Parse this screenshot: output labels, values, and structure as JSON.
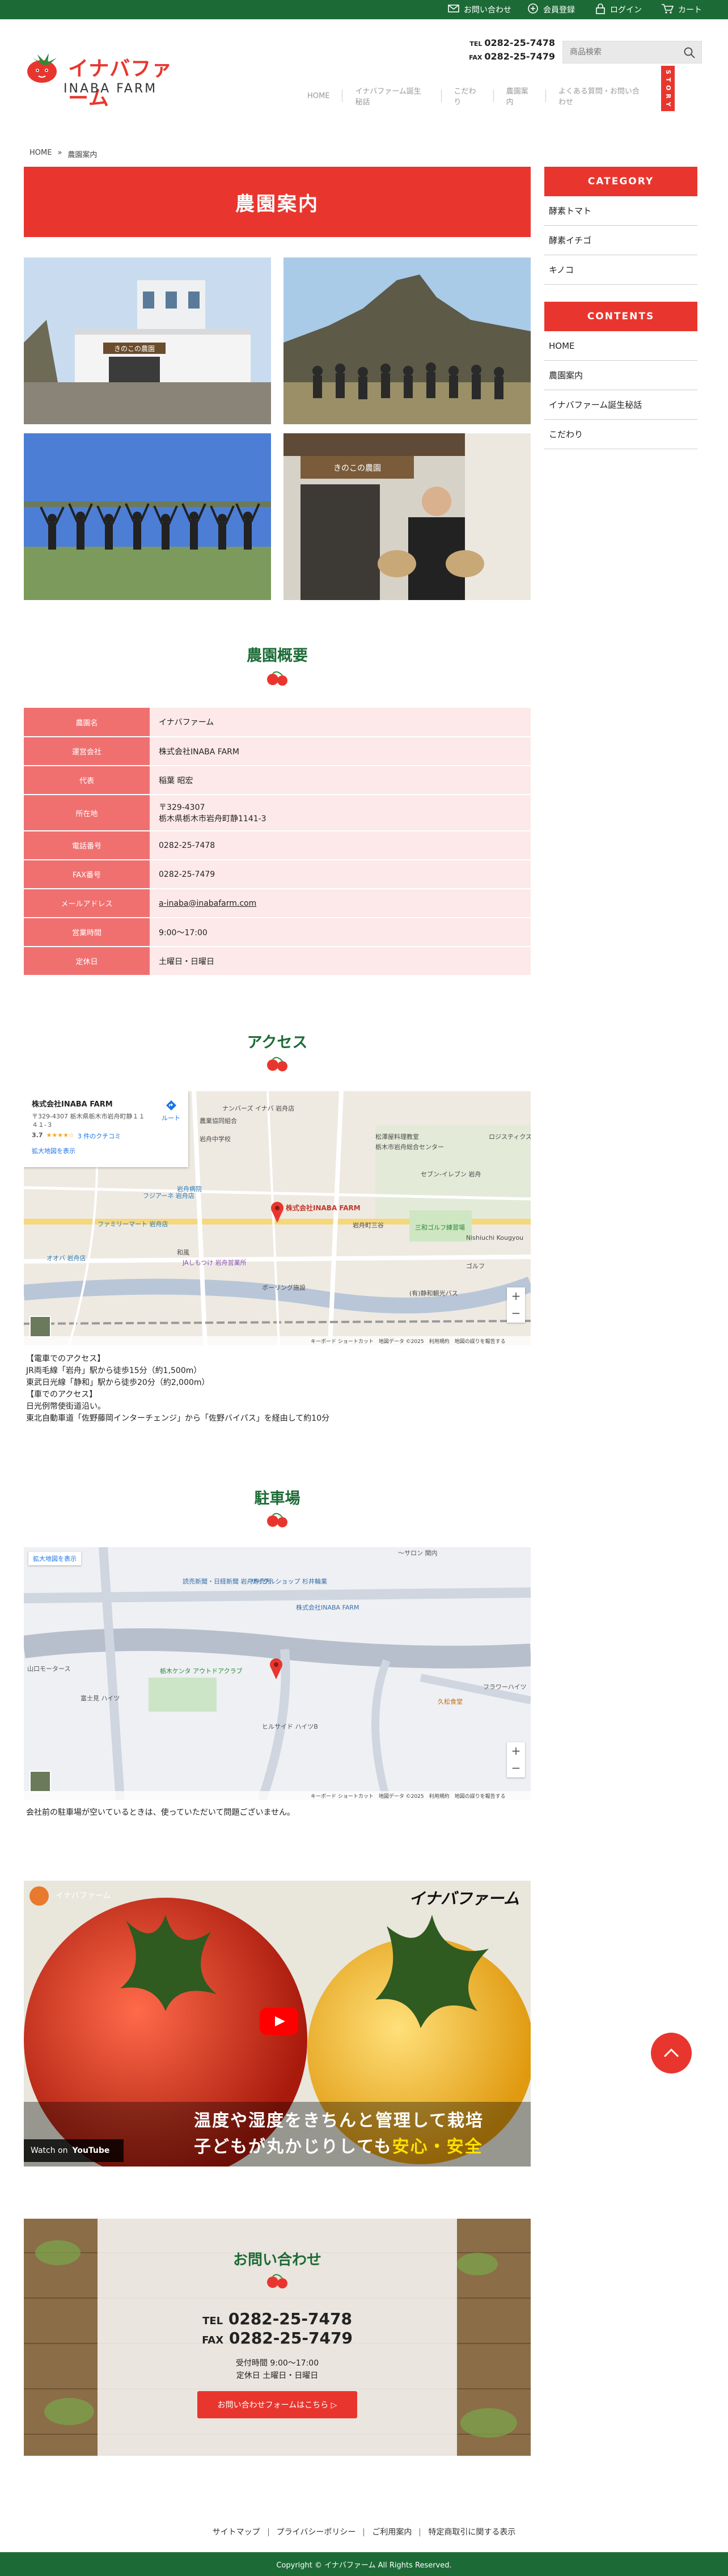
{
  "topbar": {
    "contact": "お問い合わせ",
    "register": "会員登録",
    "login": "ログイン",
    "cart": "カート"
  },
  "header": {
    "logo_jp": "イナバファーム",
    "logo_en": "INABA FARM",
    "tel_label": "TEL",
    "tel": "0282-25-7478",
    "fax_label": "FAX",
    "fax": "0282-25-7479",
    "search_placeholder": "商品検索",
    "story": "S T O R Y",
    "nav": [
      "HOME",
      "イナバファーム誕生秘話",
      "こだわり",
      "農園案内",
      "よくある質問・お問い合わせ"
    ]
  },
  "breadcrumb": {
    "home": "HOME",
    "sep": "»",
    "current": "農園案内"
  },
  "page_title": "農園案内",
  "photos": {
    "p1_sign": "きのこの農園",
    "p4_sign": "きのこの農園"
  },
  "overview": {
    "title": "農園概要",
    "rows": [
      {
        "label": "農園名",
        "value": "イナバファーム"
      },
      {
        "label": "運営会社",
        "value": "株式会社INABA FARM"
      },
      {
        "label": "代表",
        "value": "稲葉 昭宏"
      },
      {
        "label": "所在地",
        "value": "〒329-4307",
        "value2": "栃木県栃木市岩舟町静1141-3"
      },
      {
        "label": "電話番号",
        "value": "0282-25-7478"
      },
      {
        "label": "FAX番号",
        "value": "0282-25-7479"
      },
      {
        "label": "メールアドレス",
        "value": "a-inaba@inabafarm.com"
      },
      {
        "label": "営業時間",
        "value": "9:00〜17:00"
      },
      {
        "label": "定休日",
        "value": "土曜日・日曜日"
      }
    ]
  },
  "access": {
    "title": "アクセス",
    "map": {
      "card_title": "株式会社INABA FARM",
      "card_addr": "〒329-4307 栃木県栃木市岩舟町静１１４１-３",
      "card_rating": "3.7",
      "card_reviews": "3 件のクチコミ",
      "card_route": "ルート",
      "card_larger": "拡大地図を表示",
      "pin_label": "株式会社INABA FARM",
      "labels": [
        "ナンバーズ イナバ 岩舟店",
        "岩舟中学校",
        "農業協同組合",
        "ファミリーマート 岩舟店",
        "岩舟町三谷",
        "三和ゴルフ練習場",
        "ゴルフ",
        "セブン-イレブン 岩舟",
        "岩舟病院",
        "フジアーネ 岩舟店",
        "オオバ 岩舟店",
        "和風",
        "JAしもつけ 岩舟営業所",
        "ボーリング施設",
        "(有)静和観光バス",
        "Nishiuchi Kougyou",
        "栃木市岩舟総合センター",
        "松澤屋料理教室",
        "ロジスティクス"
      ],
      "footer": "キーボード ショートカット　地図データ ©2025　利用規約　地図の誤りを報告する"
    },
    "lines": [
      "【電車でのアクセス】",
      "JR両毛線「岩舟」駅から徒歩15分（約1,500m）",
      "東武日光線「静和」駅から徒歩20分（約2,000m）",
      "【車でのアクセス】",
      "日光例幣使街道沿い。",
      "東北自動車道「佐野藤岡インターチェンジ」から「佐野バイパス」を経由して約10分"
    ]
  },
  "parking": {
    "title": "駐車場",
    "map": {
      "larger": "拡大地図を表示",
      "pin_label": "株式会社INABA FARM",
      "labels": [
        "〜サロン 関内",
        "読売新聞・日経新聞 岩舟専売所",
        "サイクルショップ 杉井輪業",
        "山口モータース",
        "栃木ケンタ アウトドアクラブ",
        "富士見 ハイツ",
        "ヒルサイド ハイツB",
        "久松食堂",
        "フラワーハイツ"
      ],
      "footer": "キーボード ショートカット　地図データ ©2025　利用規約　地図の誤りを報告する"
    },
    "note": "会社前の駐車場が空いているときは、使っていただいて問題ございません。"
  },
  "video": {
    "channel": "イナバファーム",
    "brand": "イナバファーム",
    "caption1": "温度や湿度をきちんと管理して栽培",
    "caption2a": "子どもが丸かじりしても",
    "caption2b": "安心・安全",
    "watch_on": "Watch on",
    "youtube": "YouTube"
  },
  "contact": {
    "title": "お問い合わせ",
    "tel_label": "TEL",
    "tel": "0282-25-7478",
    "fax_label": "FAX",
    "fax": "0282-25-7479",
    "hours": "受付時間 9:00〜17:00",
    "closed": "定休日 土曜日・日曜日",
    "button": "お問い合わせフォームはこちら ▷"
  },
  "sidebar": {
    "category_head": "CATEGORY",
    "categories": [
      "酵素トマト",
      "酵素イチゴ",
      "キノコ"
    ],
    "contents_head": "CONTENTS",
    "contents": [
      "HOME",
      "農園案内",
      "イナバファーム誕生秘話",
      "こだわり"
    ]
  },
  "footer": {
    "links": [
      "サイトマップ",
      "プライバシーポリシー",
      "ご利用案内",
      "特定商取引に関する表示"
    ],
    "copyright": "Copyright © イナバファーム All Rights Reserved."
  },
  "colors": {
    "brand_green": "#1c6b36",
    "accent_red": "#e8362e",
    "table_label": "#f07070",
    "table_value": "#fde9e9"
  }
}
